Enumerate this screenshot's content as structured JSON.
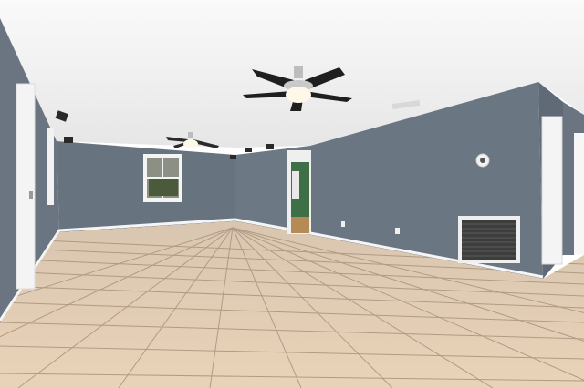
{
  "scene": {
    "kind": "empty-room-interior",
    "colors": {
      "ceiling": "#f3f3f3",
      "wall_main": "#6b7683",
      "wall_side": "#6a7581",
      "wall_shadow": "#5d6874",
      "baseboard": "#f5f5f5",
      "floor_tile": "#e2ccb2",
      "floor_grout": "#a8927c",
      "door": "#f4f4f4",
      "hallway_green": "#3f6f46",
      "fan_blade": "#1f1f1f",
      "light_globe": "#fdf8e8",
      "vent": "#4a4a4a"
    },
    "icons": [
      "ceiling-fan-icon",
      "window-icon",
      "door-icon",
      "vent-icon",
      "track-light-icon",
      "thermostat-icon",
      "outlet-icon"
    ]
  }
}
